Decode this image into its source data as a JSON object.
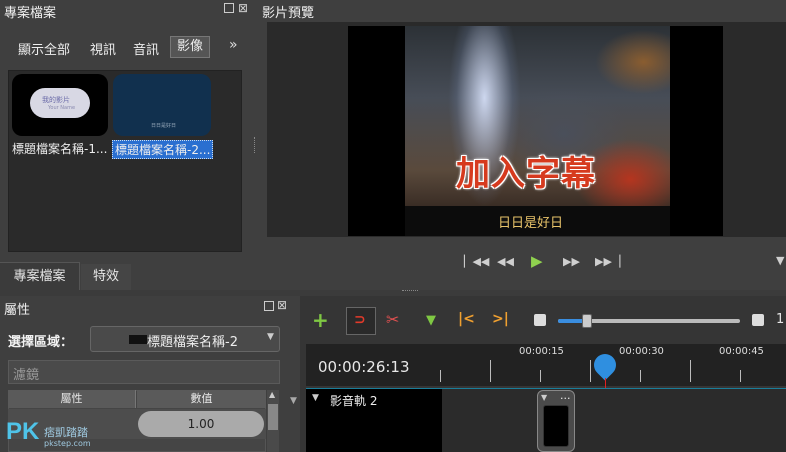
{
  "project_panel": {
    "title": "專案檔案",
    "tabs": [
      "顯示全部",
      "視訊",
      "音訊",
      "影像"
    ],
    "more": "»",
    "items": [
      {
        "caption": "標題檔案名稱-1...",
        "thumb_title": "我的影片",
        "thumb_sub": "Your Name"
      },
      {
        "caption": "標題檔案名稱-2...",
        "thumb_title": "日日是好日"
      }
    ],
    "bottom_tabs": [
      "專案檔案",
      "特效"
    ]
  },
  "preview": {
    "title": "影片預覽",
    "overlay_text": "加入字幕",
    "subtitle": "日日是好日"
  },
  "properties": {
    "title": "屬性",
    "select_label": "選擇區域：",
    "select_value": "標題檔案名稱-2",
    "filter_placeholder": "濾鏡",
    "col_name": "屬性",
    "col_value": "數值",
    "row_value": "1.00"
  },
  "timeline": {
    "timecode": "00:00:26:13",
    "ruler": [
      "00:00:15",
      "00:00:30",
      "00:00:45"
    ],
    "track_name": "影音軌 2",
    "zoom_value": "1",
    "clip_menu": "..."
  },
  "watermark": {
    "logo": "PK",
    "text": "痞凱踏踏",
    "site": "pkstep.com"
  }
}
